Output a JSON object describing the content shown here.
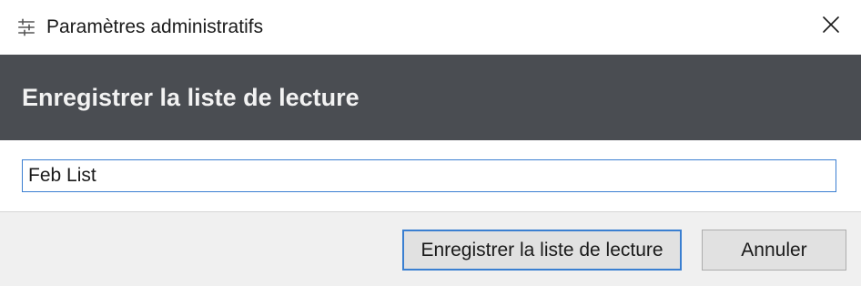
{
  "window": {
    "title": "Paramètres administratifs",
    "app_icon": "sliders-icon",
    "close_icon": "close-icon"
  },
  "header": {
    "title": "Enregistrer la liste de lecture"
  },
  "form": {
    "playlist_name_value": "Feb List"
  },
  "footer": {
    "save_label": "Enregistrer la liste de lecture",
    "cancel_label": "Annuler"
  },
  "colors": {
    "header_background": "#4a4d52",
    "accent": "#3a7fd1",
    "footer_background": "#f0f0f0"
  }
}
